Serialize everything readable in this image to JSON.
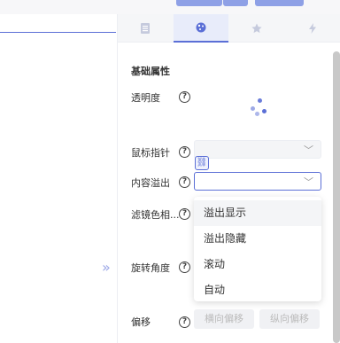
{
  "tabs": [
    {
      "icon": "list-icon"
    },
    {
      "icon": "palette-icon",
      "active": true
    },
    {
      "icon": "star-icon"
    },
    {
      "icon": "lightning-icon"
    }
  ],
  "panel": {
    "section_title": "基础属性",
    "opacity_label": "透明度",
    "cursor_label": "鼠标指针",
    "overflow_label": "内容溢出",
    "filter_label": "滤镜色相...",
    "rotate_label": "旋转角度",
    "offset_label": "偏移",
    "help_glyph": "?",
    "chevron_glyph": "﹀",
    "dropdown_options": [
      "溢出显示",
      "溢出隐藏",
      "滚动",
      "自动"
    ],
    "offset_x_placeholder": "横向偏移",
    "offset_y_placeholder": "纵向偏移",
    "collapse_glyph": "»",
    "link_glyph": "⛓"
  },
  "colors": {
    "accent": "#5b6fd6",
    "topbar_button": "#8ea0e6"
  }
}
